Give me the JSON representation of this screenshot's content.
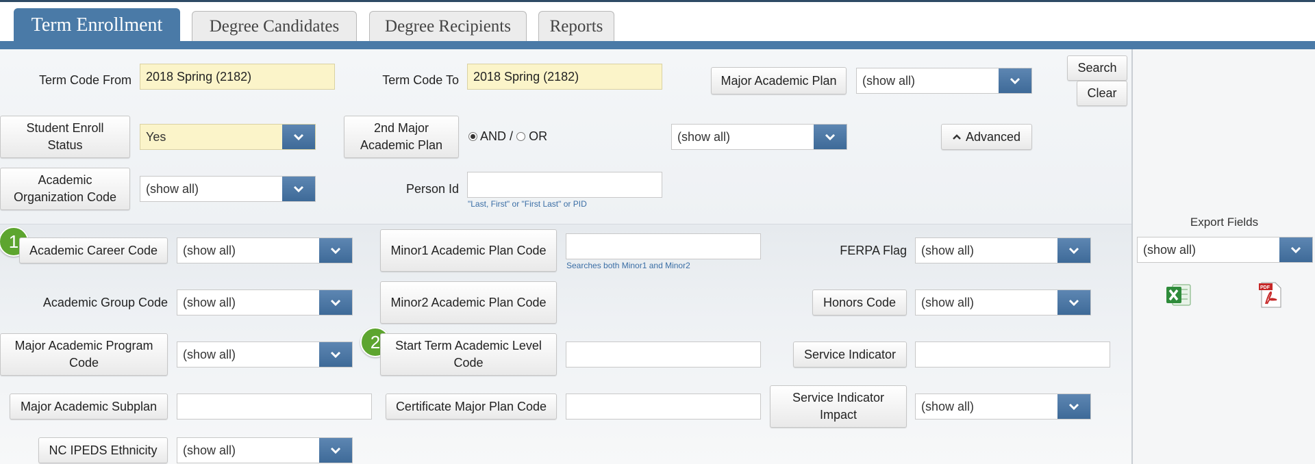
{
  "tabs": [
    "Term Enrollment",
    "Degree Candidates",
    "Degree Recipients",
    "Reports"
  ],
  "labels": {
    "term_code_from": "Term Code From",
    "term_code_to": "Term Code To",
    "person_id": "Person Id",
    "academic_group_code": "Academic Group Code",
    "ferpa_flag": "FERPA Flag"
  },
  "values": {
    "term_from": "2018 Spring (2182)",
    "term_to": "2018 Spring (2182)",
    "student_enroll_status": "Yes",
    "show_all": "(show all)"
  },
  "buttons": {
    "search": "Search",
    "clear": "Clear",
    "major_academic_plan": "Major Academic Plan",
    "student_enroll_status": "Student Enroll Status",
    "second_major_plan": "2nd Major Academic Plan",
    "advanced": "Advanced",
    "academic_org_code": "Academic Organization Code",
    "academic_career_code": "Academic Career Code",
    "minor1_plan_code": "Minor1 Academic Plan Code",
    "minor2_plan_code": "Minor2 Academic Plan Code",
    "honors_code": "Honors Code",
    "major_academic_program_code": "Major Academic Program Code",
    "start_term_academic_level_code": "Start Term Academic Level Code",
    "service_indicator": "Service Indicator",
    "major_academic_subplan": "Major Academic Subplan",
    "certificate_major_plan_code": "Certificate Major Plan Code",
    "service_indicator_impact": "Service Indicator Impact",
    "nc_ipeds_ethnicity": "NC IPEDS Ethnicity"
  },
  "radio": {
    "and_label": "AND /",
    "or_label": "OR",
    "selected": "AND"
  },
  "hints": {
    "person_id": "\"Last, First\" or \"First Last\" or PID",
    "minor": "Searches both Minor1 and Minor2"
  },
  "badges": [
    "1",
    "2"
  ],
  "export": {
    "title": "Export Fields",
    "value": "(show all)"
  },
  "colors": {
    "tab_active": "#4a7aa7",
    "dropdown_arrow": "#3e6a98",
    "highlight_field": "#fbf4c9",
    "badge": "#5da52f"
  },
  "icons": [
    "chevron-down-icon",
    "chevron-up-icon",
    "excel-icon",
    "pdf-icon"
  ]
}
